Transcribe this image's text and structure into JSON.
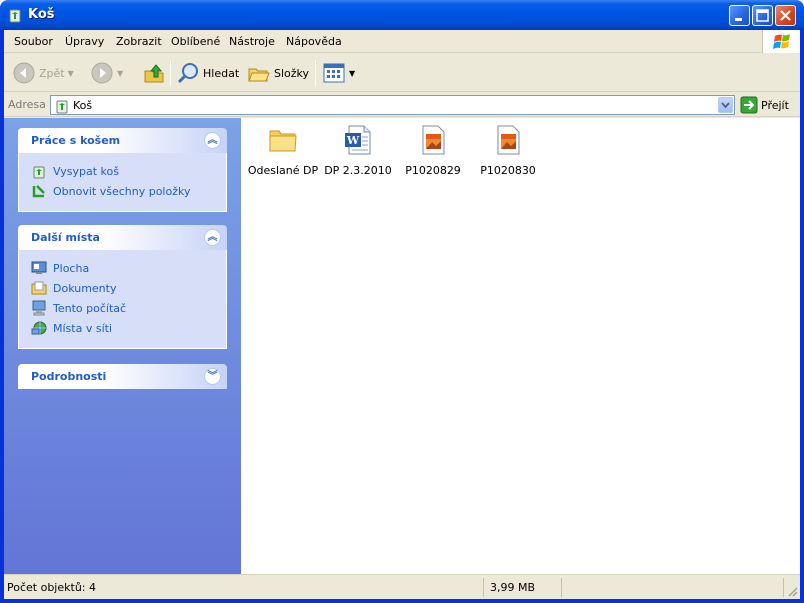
{
  "window": {
    "title": "Koš",
    "icon": "recycle-bin-icon"
  },
  "menu": [
    "Soubor",
    "Úpravy",
    "Zobrazit",
    "Oblíbené",
    "Nástroje",
    "Nápověda"
  ],
  "toolbar": {
    "back_label": "Zpět",
    "search_label": "Hledat",
    "folders_label": "Složky"
  },
  "address": {
    "label": "Adresa",
    "value": "Koš",
    "go_label": "Přejít"
  },
  "taskpane": {
    "panels": [
      {
        "title": "Práce s košem",
        "items": [
          {
            "label": "Vysypat koš",
            "icon": "empty-bin-icon"
          },
          {
            "label": "Obnovit všechny položky",
            "icon": "restore-icon"
          }
        ]
      },
      {
        "title": "Další místa",
        "items": [
          {
            "label": "Plocha",
            "icon": "desktop-icon"
          },
          {
            "label": "Dokumenty",
            "icon": "documents-icon"
          },
          {
            "label": "Tento počítač",
            "icon": "computer-icon"
          },
          {
            "label": "Místa v síti",
            "icon": "network-icon"
          }
        ]
      },
      {
        "title": "Podrobnosti",
        "items": []
      }
    ]
  },
  "files": [
    {
      "name": "Odeslané DP",
      "icon": "folder-icon"
    },
    {
      "name": "DP 2.3.2010",
      "icon": "word-document-icon"
    },
    {
      "name": "P1020829",
      "icon": "image-file-icon"
    },
    {
      "name": "P1020830",
      "icon": "image-file-icon"
    }
  ],
  "status": {
    "count": "Počet objektů: 4",
    "size": "3,99 MB"
  },
  "colors": {
    "titlebar": "#0055e5",
    "link": "#215dc6",
    "pane_bg": "#7ba2e7"
  }
}
